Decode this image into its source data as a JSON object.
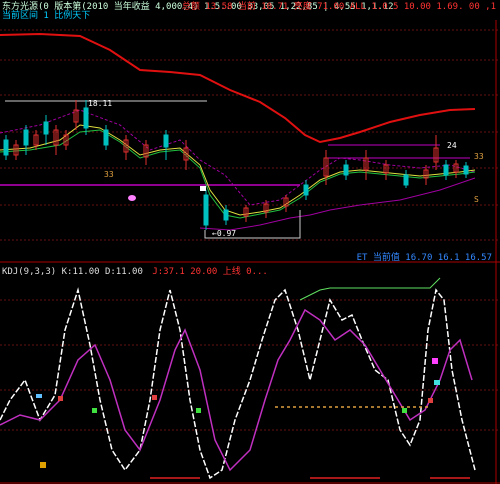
{
  "header": {
    "title": "东方光源(0 版本第(2010 当年收益 4,000,4) 1.5..00  33,05 1,22,85 | 4,55 1,1.12",
    "status": "当前区间 1 比例天下",
    "right_text": "总额 13.58 当前 10.71 亮度 71.00   ALL 1.0.5  10.00  1.69.  00 ,1"
  },
  "main_chart": {
    "labels": {
      "high_marker": "18.11",
      "low_marker": "←0.97",
      "mid_left": "33",
      "right_top": "33",
      "right_mid": "24",
      "right_small": "S"
    },
    "bottom_right_info": "ET 当前值 16.70  16.1   16.57"
  },
  "indicator": {
    "bar_left": "KDJ(9,3,3) K:11.00  D:11.00",
    "bar_right": "J:37.1   20.00  上线 0..."
  },
  "colors": {
    "background": "#000000",
    "red_ma": "#e01010",
    "yellow_ma": "#e0e040",
    "green_ma": "#20c040",
    "purple": "#c000c0",
    "white_line": "#ffffff",
    "up_candle": "#00c0c0",
    "down_candle": "#e03030",
    "grid": "#661111"
  }
}
